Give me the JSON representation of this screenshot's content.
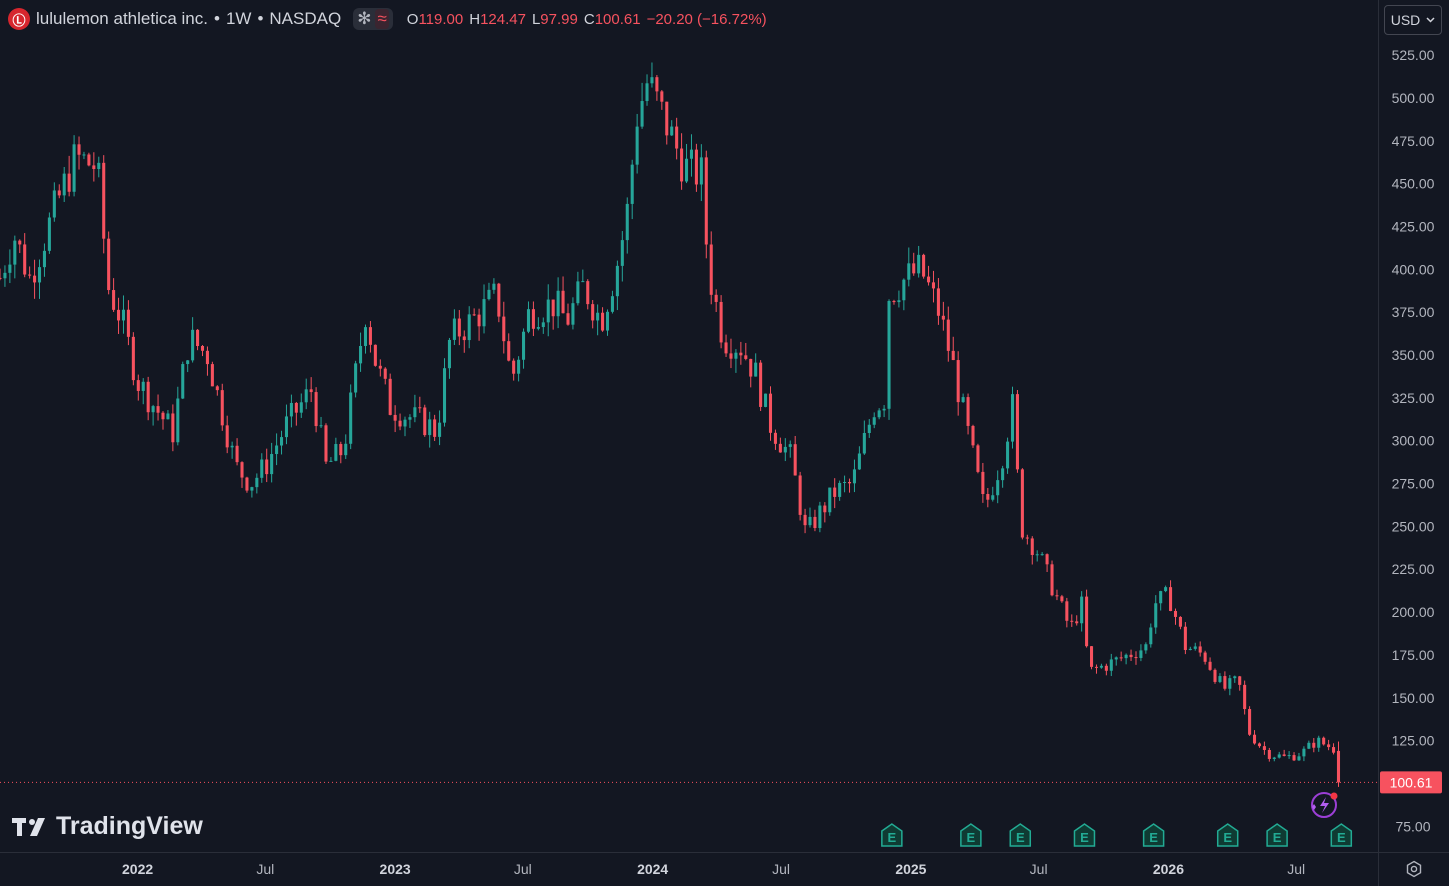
{
  "header": {
    "logo_glyph": "Ⓛ",
    "symbol_name": "lululemon athletica inc.",
    "sep1": "•",
    "interval": "1W",
    "sep2": "•",
    "exchange": "NASDAQ",
    "pill_icon_1": "✻",
    "pill_icon_2": "≈",
    "ohlc": {
      "o_label": "O",
      "o_value": "119.00",
      "h_label": "H",
      "h_value": "124.47",
      "l_label": "L",
      "l_value": "97.99",
      "c_label": "C",
      "c_value": "100.61",
      "change": "−20.20 (−16.72%)"
    }
  },
  "currency": {
    "label": "USD",
    "icon": "chevron-down-icon"
  },
  "watermark": {
    "text": "TradingView"
  },
  "colors": {
    "up": "#26a69a",
    "down": "#f7525f",
    "background": "#131722",
    "price_label_bg": "#f7525f",
    "earnings": "#22ab94"
  },
  "chart_data": {
    "type": "candlestick",
    "interval": "1W",
    "ylim": [
      60,
      535
    ],
    "y_ticks": [
      "525.00",
      "500.00",
      "475.00",
      "450.00",
      "425.00",
      "400.00",
      "375.00",
      "350.00",
      "325.00",
      "300.00",
      "275.00",
      "250.00",
      "225.00",
      "200.00",
      "175.00",
      "150.00",
      "125.00",
      "75.00"
    ],
    "x_ticks": [
      "2022",
      "Jul",
      "2023",
      "Jul",
      "2024",
      "Jul",
      "2025",
      "Jul",
      "2026",
      "Jul"
    ],
    "x_tick_dates": [
      "2022-01-01",
      "2022-07-01",
      "2023-01-01",
      "2023-07-01",
      "2024-01-01",
      "2024-07-01",
      "2025-01-01",
      "2025-07-01",
      "2026-01-01",
      "2026-07-01"
    ],
    "x_range": [
      "2021-06-20",
      "2026-10-25"
    ],
    "last_price": "100.61",
    "earnings_marker_label": "E",
    "earnings_dates": [
      "2024-12-05",
      "2025-03-27",
      "2025-06-05",
      "2025-09-04",
      "2025-12-11",
      "2026-03-26",
      "2026-06-04",
      "2026-09-03"
    ],
    "price_path": [
      [
        "2021-06-20",
        395
      ],
      [
        "2021-07-10",
        420
      ],
      [
        "2021-08-01",
        395
      ],
      [
        "2021-08-15",
        410
      ],
      [
        "2021-09-10",
        440
      ],
      [
        "2021-10-05",
        465
      ],
      [
        "2021-11-05",
        460
      ],
      [
        "2021-11-20",
        390
      ],
      [
        "2021-12-10",
        370
      ],
      [
        "2022-01-01",
        335
      ],
      [
        "2022-01-25",
        320
      ],
      [
        "2022-02-20",
        305
      ],
      [
        "2022-03-15",
        360
      ],
      [
        "2022-04-10",
        350
      ],
      [
        "2022-05-20",
        285
      ],
      [
        "2022-06-10",
        275
      ],
      [
        "2022-07-01",
        285
      ],
      [
        "2022-08-01",
        310
      ],
      [
        "2022-09-05",
        330
      ],
      [
        "2022-09-25",
        285
      ],
      [
        "2022-10-20",
        295
      ],
      [
        "2022-11-20",
        375
      ],
      [
        "2022-12-05",
        345
      ],
      [
        "2022-12-25",
        320
      ],
      [
        "2023-01-15",
        315
      ],
      [
        "2023-02-15",
        310
      ],
      [
        "2023-03-01",
        305
      ],
      [
        "2023-03-20",
        360
      ],
      [
        "2023-04-20",
        370
      ],
      [
        "2023-05-25",
        385
      ],
      [
        "2023-06-15",
        335
      ],
      [
        "2023-07-10",
        375
      ],
      [
        "2023-08-15",
        380
      ],
      [
        "2023-09-01",
        370
      ],
      [
        "2023-09-25",
        390
      ],
      [
        "2023-10-20",
        370
      ],
      [
        "2023-11-10",
        400
      ],
      [
        "2023-11-25",
        430
      ],
      [
        "2023-12-10",
        490
      ],
      [
        "2023-12-25",
        510
      ],
      [
        "2024-01-20",
        485
      ],
      [
        "2024-02-15",
        460
      ],
      [
        "2024-03-10",
        455
      ],
      [
        "2024-03-20",
        400
      ],
      [
        "2024-04-10",
        360
      ],
      [
        "2024-05-05",
        355
      ],
      [
        "2024-05-25",
        340
      ],
      [
        "2024-06-15",
        310
      ],
      [
        "2024-07-15",
        290
      ],
      [
        "2024-08-05",
        245
      ],
      [
        "2024-08-20",
        255
      ],
      [
        "2024-09-15",
        270
      ],
      [
        "2024-10-10",
        275
      ],
      [
        "2024-11-10",
        320
      ],
      [
        "2024-11-25",
        325
      ],
      [
        "2024-12-01",
        385
      ],
      [
        "2024-12-25",
        395
      ],
      [
        "2025-01-15",
        400
      ],
      [
        "2025-02-10",
        375
      ],
      [
        "2025-03-01",
        345
      ],
      [
        "2025-03-25",
        300
      ],
      [
        "2025-04-15",
        260
      ],
      [
        "2025-05-10",
        290
      ],
      [
        "2025-05-25",
        320
      ],
      [
        "2025-06-06",
        250
      ],
      [
        "2025-06-30",
        235
      ],
      [
        "2025-07-20",
        215
      ],
      [
        "2025-08-15",
        190
      ],
      [
        "2025-09-01",
        205
      ],
      [
        "2025-09-10",
        165
      ],
      [
        "2025-10-10",
        170
      ],
      [
        "2025-11-05",
        175
      ],
      [
        "2025-11-30",
        180
      ],
      [
        "2025-12-12",
        205
      ],
      [
        "2026-01-01",
        210
      ],
      [
        "2026-01-25",
        180
      ],
      [
        "2026-02-20",
        175
      ],
      [
        "2026-03-20",
        155
      ],
      [
        "2026-04-10",
        160
      ],
      [
        "2026-04-25",
        130
      ],
      [
        "2026-05-20",
        118
      ],
      [
        "2026-06-15",
        115
      ],
      [
        "2026-07-10",
        118
      ],
      [
        "2026-07-30",
        125
      ],
      [
        "2026-08-25",
        120
      ],
      [
        "2026-09-05",
        100.61
      ]
    ]
  }
}
